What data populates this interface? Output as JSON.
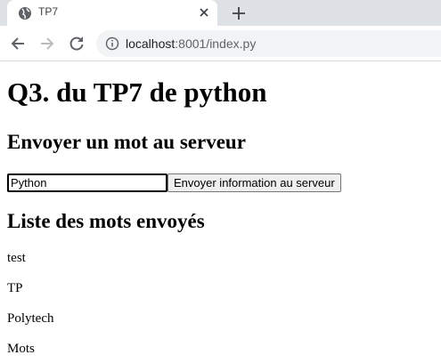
{
  "browser": {
    "tab_title": "TP7",
    "url_host": "localhost",
    "url_rest": ":8001/index.py"
  },
  "page": {
    "title": "Q3. du TP7 de python",
    "send_heading": "Envoyer un mot au serveur",
    "input_value": "Python",
    "send_button_label": "Envoyer information au serveur",
    "list_heading": "Liste des mots envoyés",
    "words": [
      "test",
      "TP",
      "Polytech",
      "Mots"
    ]
  }
}
